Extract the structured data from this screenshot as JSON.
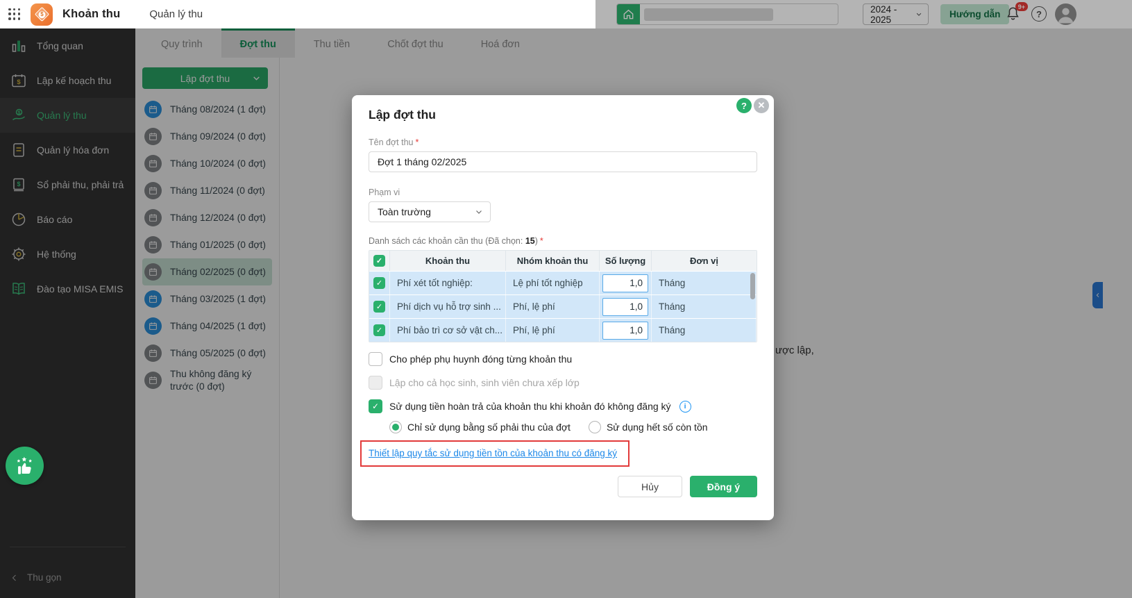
{
  "topbar": {
    "app_title": "Khoản thu",
    "module_tab": "Quản lý thu",
    "school_year": "2024 - 2025",
    "guide_button": "Hướng dẫn",
    "notification_badge": "9+"
  },
  "tabs": [
    {
      "label": "Quy trình",
      "active": false
    },
    {
      "label": "Đợt thu",
      "active": true
    },
    {
      "label": "Thu tiền",
      "active": false
    },
    {
      "label": "Chốt đợt thu",
      "active": false
    },
    {
      "label": "Hoá đơn",
      "active": false
    }
  ],
  "sidebar": {
    "items": [
      {
        "label": "Tổng quan",
        "icon": "bar-chart",
        "active": false
      },
      {
        "label": "Lập kế hoạch thu",
        "icon": "calendar-money",
        "active": false
      },
      {
        "label": "Quản lý thu",
        "icon": "hand-coin",
        "active": true
      },
      {
        "label": "Quản lý hóa đơn",
        "icon": "invoice",
        "active": false
      },
      {
        "label": "Sổ phải thu, phải trả",
        "icon": "ledger",
        "active": false
      },
      {
        "label": "Báo cáo",
        "icon": "pie-chart",
        "active": false
      },
      {
        "label": "Hệ thống",
        "icon": "gear",
        "active": false
      },
      {
        "label": "Đào tạo MISA EMIS",
        "icon": "open-book",
        "active": false
      }
    ],
    "collapse_label": "Thu gọn"
  },
  "month_panel": {
    "create_button": "Lập đợt thu",
    "months": [
      {
        "label": "Tháng 08/2024 (1 đợt)",
        "has_batches": true,
        "selected": false
      },
      {
        "label": "Tháng 09/2024 (0 đợt)",
        "has_batches": false,
        "selected": false
      },
      {
        "label": "Tháng 10/2024 (0 đợt)",
        "has_batches": false,
        "selected": false
      },
      {
        "label": "Tháng 11/2024 (0 đợt)",
        "has_batches": false,
        "selected": false
      },
      {
        "label": "Tháng 12/2024 (0 đợt)",
        "has_batches": false,
        "selected": false
      },
      {
        "label": "Tháng 01/2025 (0 đợt)",
        "has_batches": false,
        "selected": false
      },
      {
        "label": "Tháng 02/2025 (0 đợt)",
        "has_batches": false,
        "selected": true
      },
      {
        "label": "Tháng 03/2025 (1 đợt)",
        "has_batches": true,
        "selected": false
      },
      {
        "label": "Tháng 04/2025 (1 đợt)",
        "has_batches": true,
        "selected": false
      },
      {
        "label": "Tháng 05/2025 (0 đợt)",
        "has_batches": false,
        "selected": false
      },
      {
        "label": "Thu không đăng ký trước (0 đợt)",
        "has_batches": false,
        "selected": false
      }
    ]
  },
  "background": {
    "partial_text": "ược lập,"
  },
  "modal": {
    "title": "Lập đợt thu",
    "help_icon": "?",
    "name_field": {
      "label": "Tên đợt thu",
      "value": "Đợt 1 tháng 02/2025"
    },
    "scope_field": {
      "label": "Phạm vi",
      "value": "Toàn trường"
    },
    "list_label": {
      "prefix": "Danh sách các khoản cần thu (Đã chọn: ",
      "count": "15",
      "suffix": ")"
    },
    "table": {
      "columns": [
        "Khoản thu",
        "Nhóm khoản thu",
        "Số lượng",
        "Đơn vị"
      ],
      "rows": [
        {
          "name": "Phí xét tốt nghiệp:",
          "group": "Lệ phí tốt nghiệp",
          "qty": "1,0",
          "unit": "Tháng",
          "checked": true
        },
        {
          "name": "Phí dịch vụ hỗ trợ sinh ...",
          "group": "Phí, lệ phí",
          "qty": "1,0",
          "unit": "Tháng",
          "checked": true
        },
        {
          "name": "Phí bảo trì cơ sở vật ch...",
          "group": "Phí, lệ phí",
          "qty": "1,0",
          "unit": "Tháng",
          "checked": true
        }
      ]
    },
    "checkboxes": [
      {
        "label": "Cho phép phụ huynh đóng từng khoản thu",
        "checked": false,
        "disabled": false
      },
      {
        "label": "Lập cho cả học sinh, sinh viên chưa xếp lớp",
        "checked": false,
        "disabled": true
      },
      {
        "label": "Sử dụng tiền hoàn trả của khoản thu khi khoản đó không đăng ký",
        "checked": true,
        "disabled": false
      }
    ],
    "radios": [
      {
        "label": "Chỉ sử dụng bằng số phải thu của đợt",
        "selected": true
      },
      {
        "label": "Sử dụng hết số còn tồn",
        "selected": false
      }
    ],
    "link_text": "Thiết lập quy tắc sử dụng tiền tồn của khoản thu có đăng ký",
    "cancel_button": "Hủy",
    "ok_button": "Đồng ý"
  },
  "colors": {
    "green": "#2ab06c",
    "calendar_blue": "#2b95e5",
    "link_blue": "#1d88e8",
    "highlight_red": "#e23a3a",
    "badge_red": "#e53935"
  }
}
